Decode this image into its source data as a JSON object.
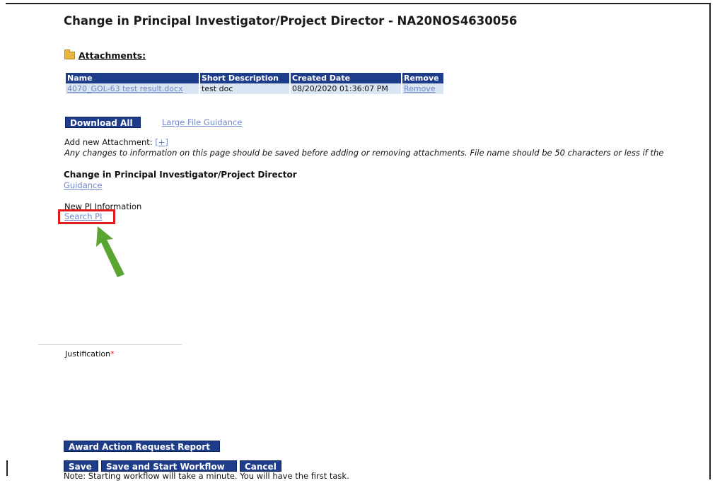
{
  "page_title": "Change in Principal Investigator/Project Director - NA20NOS4630056",
  "attachments": {
    "heading": "Attachments:",
    "columns": [
      "Name",
      "Short Description",
      "Created Date",
      "Remove"
    ],
    "rows": [
      {
        "name": "4070_GOL-63 test result.docx",
        "description": "test doc",
        "created": "08/20/2020 01:36:07 PM",
        "remove": "Remove"
      }
    ]
  },
  "download_all_label": "Download All",
  "large_file_guidance_label": "Large File Guidance",
  "add_attachment_label": "Add new Attachment:",
  "add_attachment_plus": "[+]",
  "notice_text": "Any changes to information on this page should be saved before adding or removing attachments. File name should be 50 characters or less if the",
  "section": {
    "title": "Change in Principal Investigator/Project Director",
    "guidance_label": "Guidance",
    "new_pi_label": "New PI Information",
    "search_pi_label": "Search PI"
  },
  "justification_label": "Justification",
  "required_marker": "*",
  "buttons": {
    "award_report": "Award Action Request Report",
    "save": "Save",
    "save_start_workflow": "Save and Start Workflow",
    "cancel": "Cancel"
  },
  "workflow_note": "Note: Starting workflow will take a minute. You will have the first task.",
  "colors": {
    "header_blue": "#1d3c8a",
    "highlight_red": "#e01b1b",
    "arrow_green": "#5aa532"
  }
}
